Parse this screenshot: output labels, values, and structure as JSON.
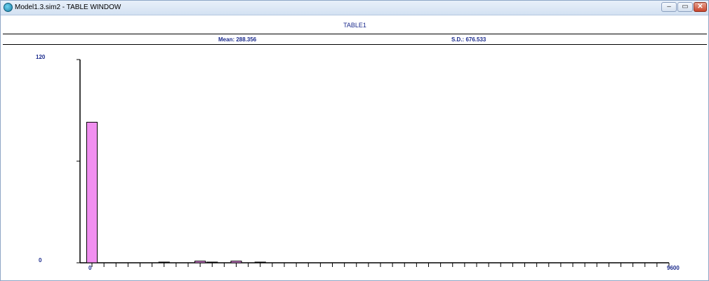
{
  "window": {
    "title": "Model1.3.sim2 - TABLE WINDOW",
    "controls": {
      "minimize": "–",
      "maximize": "▭",
      "close": "✕"
    }
  },
  "table": {
    "title": "TABLE1",
    "mean_label": "Mean: 288.356",
    "sd_label": "S.D.: 676.533"
  },
  "chart_data": {
    "type": "bar",
    "title": "TABLE1",
    "xlabel": "",
    "ylabel": "",
    "xlim": [
      0,
      9600
    ],
    "ylim": [
      0,
      120
    ],
    "x_tick_labels": [
      "0",
      "9600"
    ],
    "y_tick_labels": [
      "0",
      "120"
    ],
    "bin_count": 49,
    "bins": [
      {
        "x": 0,
        "value": 83
      },
      {
        "x": 1200,
        "value": 0.3
      },
      {
        "x": 1800,
        "value": 1
      },
      {
        "x": 2000,
        "value": 0.3
      },
      {
        "x": 2400,
        "value": 1
      },
      {
        "x": 2800,
        "value": 0.3
      }
    ],
    "bar_color": "#f18ff0",
    "bar_edge": "#000000",
    "text_color": "#1a2a8c",
    "grid": false
  }
}
